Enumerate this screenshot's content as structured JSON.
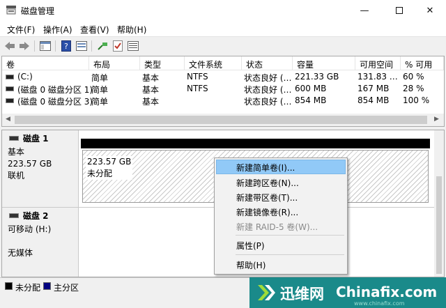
{
  "window": {
    "title": "磁盘管理",
    "icons": {
      "app": "disk-management-icon",
      "minimize": "minimize-icon",
      "maximize": "maximize-icon",
      "close": "close-icon"
    }
  },
  "menubar": [
    "文件(F)",
    "操作(A)",
    "查看(V)",
    "帮助(H)"
  ],
  "toolbar": [
    "back-arrow-icon",
    "forward-arrow-icon",
    "show-hide-console-tree-icon",
    "help-icon",
    "properties-icon",
    "connect-icon",
    "check-icon",
    "list-view-icon"
  ],
  "volume_table": {
    "columns": [
      "卷",
      "布局",
      "类型",
      "文件系统",
      "状态",
      "容量",
      "可用空间",
      "% 可用"
    ],
    "rows": [
      [
        "(C:)",
        "简单",
        "基本",
        "NTFS",
        "状态良好 (…",
        "221.33 GB",
        "131.83 …",
        "60 %"
      ],
      [
        "(磁盘 0 磁盘分区 1)",
        "简单",
        "基本",
        "NTFS",
        "状态良好 (…",
        "600 MB",
        "167 MB",
        "28 %"
      ],
      [
        "(磁盘 0 磁盘分区 3)",
        "简单",
        "基本",
        "",
        "状态良好 (…",
        "854 MB",
        "854 MB",
        "100 %"
      ]
    ]
  },
  "disks": [
    {
      "name": "磁盘 1",
      "type": "基本",
      "size": "223.57 GB",
      "status": "联机",
      "partition_size": "223.57 GB",
      "partition_status": "未分配"
    },
    {
      "name": "磁盘 2",
      "type": "可移动 (H:)",
      "status": "无媒体"
    }
  ],
  "legend": [
    {
      "label": "未分配",
      "color": "#000000"
    },
    {
      "label": "主分区",
      "color": "#000080"
    }
  ],
  "context_menu": {
    "items": [
      {
        "label": "新建简单卷(I)...",
        "highlighted": true,
        "enabled": true
      },
      {
        "label": "新建跨区卷(N)...",
        "enabled": true
      },
      {
        "label": "新建带区卷(T)...",
        "enabled": true
      },
      {
        "label": "新建镜像卷(R)...",
        "enabled": true
      },
      {
        "label": "新建 RAID-5 卷(W)...",
        "enabled": false
      },
      {
        "label": "属性(P)",
        "enabled": true
      },
      {
        "label": "帮助(H)",
        "enabled": true
      }
    ]
  },
  "watermark": {
    "cn": "迅维网",
    "en": "Chinafix.com",
    "url": "www.chinafix.com"
  },
  "colors": {
    "highlight": "#91c9f7",
    "watermark_bg": "#1a8a8a"
  }
}
